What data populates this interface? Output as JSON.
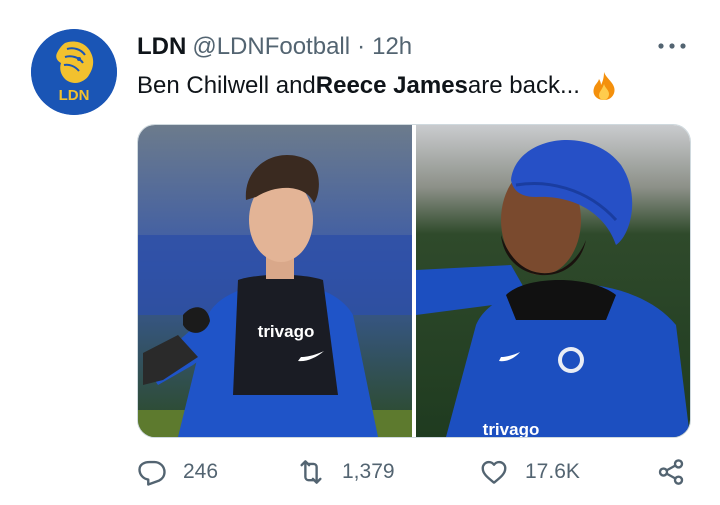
{
  "tweet": {
    "author_name": "LDN",
    "author_handle": "@LDNFootball",
    "separator": "·",
    "time": "12h",
    "text_part1": "Ben Chilwell and ",
    "text_bold": "Reece James",
    "text_part2": " are back...",
    "emoji": "fire-emoji",
    "avatar_text": "LDN",
    "left_photo_sponsor": "trivago",
    "right_photo_sponsor": "trivago"
  },
  "actions": {
    "replies": "246",
    "retweets": "1,379",
    "likes": "17.6K"
  },
  "colors": {
    "text": "#0f1419",
    "muted": "#536471",
    "avatar_bg": "#1a55b5",
    "avatar_gold": "#f2c12e",
    "chelsea_blue": "#1c4fc0"
  },
  "icons": [
    "more-icon",
    "reply-icon",
    "retweet-icon",
    "like-icon",
    "share-icon"
  ]
}
